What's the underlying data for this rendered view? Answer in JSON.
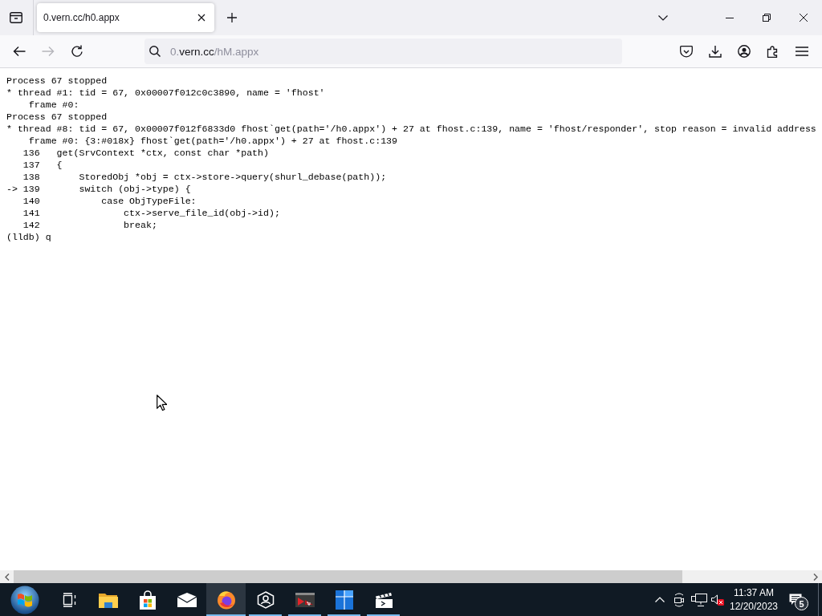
{
  "tab_strip": {
    "tabs": [
      {
        "title": "0.vern.cc/h0.appx",
        "selected": true
      }
    ]
  },
  "nav_bar": {
    "back": {
      "disabled": false
    },
    "forward": {
      "disabled": true
    },
    "address": {
      "parts": [
        {
          "text": "0.",
          "highlighted": false
        },
        {
          "text": "vern.cc",
          "highlighted": true
        },
        {
          "text": "/hM.appx",
          "highlighted": false
        }
      ]
    }
  },
  "console": {
    "lines": [
      "Process 67 stopped",
      "* thread #1: tid = 67, 0x00007f012c0c3890, name = 'fhost'",
      "    frame #0:",
      "Process 67 stopped",
      "* thread #8: tid = 67, 0x00007f012f6833d0 fhost`get(path='/h0.appx') + 27 at fhost.c:139, name = 'fhost/responder', stop reason = invalid address",
      "    frame #0: {3:#018x} fhost`get(path='/h0.appx') + 27 at fhost.c:139",
      "   136   get(SrvContext *ctx, const char *path)",
      "   137   {",
      "   138       StoredObj *obj = ctx->store->query(shurl_debase(path));",
      "-> 139       switch (obj->type) {",
      "   140           case ObjTypeFile:",
      "   141               ctx->serve_file_id(obj->id);",
      "   142               break;",
      "(lldb) q"
    ]
  },
  "taskbar": {
    "apps": [
      {
        "kind": "task_view",
        "selected": false,
        "running": false
      },
      {
        "kind": "folder",
        "selected": false,
        "running": false
      },
      {
        "kind": "store",
        "selected": false,
        "running": false
      },
      {
        "kind": "mail",
        "selected": false,
        "running": false
      },
      {
        "kind": "browser",
        "selected": true,
        "running": true
      },
      {
        "kind": "person",
        "selected": false,
        "running": true
      },
      {
        "kind": "terminal",
        "selected": false,
        "running": true
      },
      {
        "kind": "tiles",
        "selected": false,
        "running": true
      },
      {
        "kind": "clapper",
        "selected": false,
        "running": true
      }
    ],
    "tray": {
      "volume": {
        "muted": true
      }
    },
    "clock": {
      "time": "11:37 AM",
      "date": "12/20/2023"
    },
    "notifications": {
      "count": "5"
    }
  }
}
